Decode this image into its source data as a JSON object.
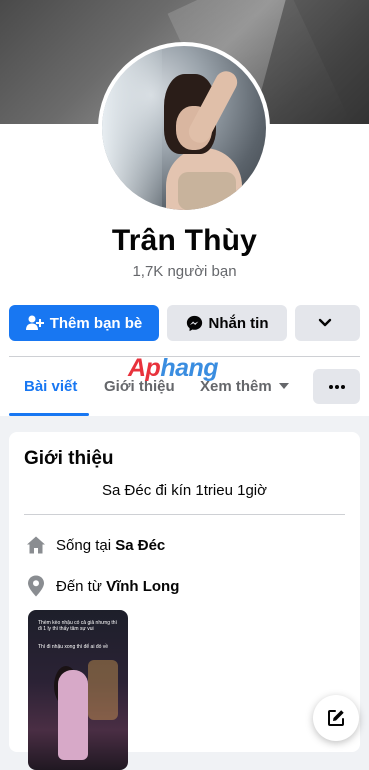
{
  "profile": {
    "name": "Trân Thùy",
    "friends_count": "1,7K người bạn"
  },
  "actions": {
    "add_friend_label": "Thêm bạn bè",
    "message_label": "Nhắn tin"
  },
  "tabs": [
    {
      "label": "Bài viết",
      "active": true
    },
    {
      "label": "Giới thiệu",
      "active": false
    },
    {
      "label": "Xem thêm",
      "active": false
    }
  ],
  "watermark": {
    "part1": "Ap",
    "part2": "hang"
  },
  "intro": {
    "title": "Giới thiệu",
    "bio": "Sa Đéc đi kín 1trieu 1giờ",
    "lives_prefix": "Sống tại ",
    "lives_place": "Sa Đéc",
    "from_prefix": "Đến từ ",
    "from_place": "Vĩnh Long"
  },
  "photo_caption": {
    "line1": "Thèm kèo nhậu có cả giả nhưng thì đi 1 ly thì thấy tâm sự vui",
    "line2": "Thì đi nhậu xong thì để ai đó về"
  },
  "icons": [
    "add-friend-icon",
    "messenger-icon",
    "chevron-down-icon",
    "caret-down-icon",
    "more-dots-icon",
    "home-icon",
    "location-pin-icon",
    "edit-icon"
  ],
  "colors": {
    "primary": "#1877f2",
    "secondary_button": "#e4e6eb",
    "page_bg": "#f0f2f5",
    "muted_text": "#65676b"
  }
}
